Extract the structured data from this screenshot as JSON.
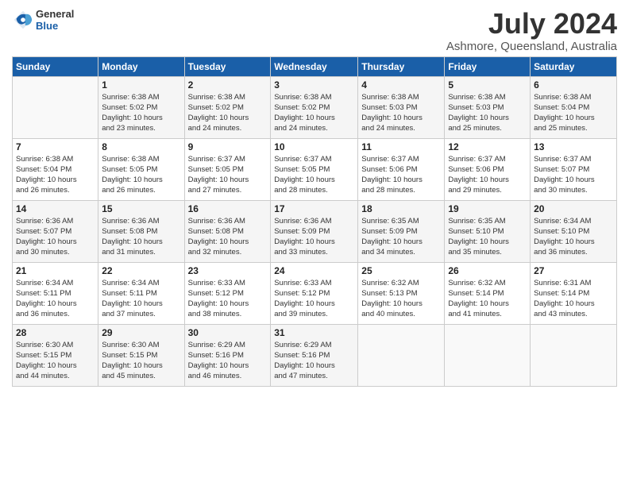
{
  "header": {
    "logo_general": "General",
    "logo_blue": "Blue",
    "title": "July 2024",
    "subtitle": "Ashmore, Queensland, Australia"
  },
  "calendar": {
    "days_of_week": [
      "Sunday",
      "Monday",
      "Tuesday",
      "Wednesday",
      "Thursday",
      "Friday",
      "Saturday"
    ],
    "weeks": [
      [
        {
          "day": "",
          "info": ""
        },
        {
          "day": "1",
          "info": "Sunrise: 6:38 AM\nSunset: 5:02 PM\nDaylight: 10 hours\nand 23 minutes."
        },
        {
          "day": "2",
          "info": "Sunrise: 6:38 AM\nSunset: 5:02 PM\nDaylight: 10 hours\nand 24 minutes."
        },
        {
          "day": "3",
          "info": "Sunrise: 6:38 AM\nSunset: 5:02 PM\nDaylight: 10 hours\nand 24 minutes."
        },
        {
          "day": "4",
          "info": "Sunrise: 6:38 AM\nSunset: 5:03 PM\nDaylight: 10 hours\nand 24 minutes."
        },
        {
          "day": "5",
          "info": "Sunrise: 6:38 AM\nSunset: 5:03 PM\nDaylight: 10 hours\nand 25 minutes."
        },
        {
          "day": "6",
          "info": "Sunrise: 6:38 AM\nSunset: 5:04 PM\nDaylight: 10 hours\nand 25 minutes."
        }
      ],
      [
        {
          "day": "7",
          "info": "Sunrise: 6:38 AM\nSunset: 5:04 PM\nDaylight: 10 hours\nand 26 minutes."
        },
        {
          "day": "8",
          "info": "Sunrise: 6:38 AM\nSunset: 5:05 PM\nDaylight: 10 hours\nand 26 minutes."
        },
        {
          "day": "9",
          "info": "Sunrise: 6:37 AM\nSunset: 5:05 PM\nDaylight: 10 hours\nand 27 minutes."
        },
        {
          "day": "10",
          "info": "Sunrise: 6:37 AM\nSunset: 5:05 PM\nDaylight: 10 hours\nand 28 minutes."
        },
        {
          "day": "11",
          "info": "Sunrise: 6:37 AM\nSunset: 5:06 PM\nDaylight: 10 hours\nand 28 minutes."
        },
        {
          "day": "12",
          "info": "Sunrise: 6:37 AM\nSunset: 5:06 PM\nDaylight: 10 hours\nand 29 minutes."
        },
        {
          "day": "13",
          "info": "Sunrise: 6:37 AM\nSunset: 5:07 PM\nDaylight: 10 hours\nand 30 minutes."
        }
      ],
      [
        {
          "day": "14",
          "info": "Sunrise: 6:36 AM\nSunset: 5:07 PM\nDaylight: 10 hours\nand 30 minutes."
        },
        {
          "day": "15",
          "info": "Sunrise: 6:36 AM\nSunset: 5:08 PM\nDaylight: 10 hours\nand 31 minutes."
        },
        {
          "day": "16",
          "info": "Sunrise: 6:36 AM\nSunset: 5:08 PM\nDaylight: 10 hours\nand 32 minutes."
        },
        {
          "day": "17",
          "info": "Sunrise: 6:36 AM\nSunset: 5:09 PM\nDaylight: 10 hours\nand 33 minutes."
        },
        {
          "day": "18",
          "info": "Sunrise: 6:35 AM\nSunset: 5:09 PM\nDaylight: 10 hours\nand 34 minutes."
        },
        {
          "day": "19",
          "info": "Sunrise: 6:35 AM\nSunset: 5:10 PM\nDaylight: 10 hours\nand 35 minutes."
        },
        {
          "day": "20",
          "info": "Sunrise: 6:34 AM\nSunset: 5:10 PM\nDaylight: 10 hours\nand 36 minutes."
        }
      ],
      [
        {
          "day": "21",
          "info": "Sunrise: 6:34 AM\nSunset: 5:11 PM\nDaylight: 10 hours\nand 36 minutes."
        },
        {
          "day": "22",
          "info": "Sunrise: 6:34 AM\nSunset: 5:11 PM\nDaylight: 10 hours\nand 37 minutes."
        },
        {
          "day": "23",
          "info": "Sunrise: 6:33 AM\nSunset: 5:12 PM\nDaylight: 10 hours\nand 38 minutes."
        },
        {
          "day": "24",
          "info": "Sunrise: 6:33 AM\nSunset: 5:12 PM\nDaylight: 10 hours\nand 39 minutes."
        },
        {
          "day": "25",
          "info": "Sunrise: 6:32 AM\nSunset: 5:13 PM\nDaylight: 10 hours\nand 40 minutes."
        },
        {
          "day": "26",
          "info": "Sunrise: 6:32 AM\nSunset: 5:14 PM\nDaylight: 10 hours\nand 41 minutes."
        },
        {
          "day": "27",
          "info": "Sunrise: 6:31 AM\nSunset: 5:14 PM\nDaylight: 10 hours\nand 43 minutes."
        }
      ],
      [
        {
          "day": "28",
          "info": "Sunrise: 6:30 AM\nSunset: 5:15 PM\nDaylight: 10 hours\nand 44 minutes."
        },
        {
          "day": "29",
          "info": "Sunrise: 6:30 AM\nSunset: 5:15 PM\nDaylight: 10 hours\nand 45 minutes."
        },
        {
          "day": "30",
          "info": "Sunrise: 6:29 AM\nSunset: 5:16 PM\nDaylight: 10 hours\nand 46 minutes."
        },
        {
          "day": "31",
          "info": "Sunrise: 6:29 AM\nSunset: 5:16 PM\nDaylight: 10 hours\nand 47 minutes."
        },
        {
          "day": "",
          "info": ""
        },
        {
          "day": "",
          "info": ""
        },
        {
          "day": "",
          "info": ""
        }
      ]
    ]
  }
}
